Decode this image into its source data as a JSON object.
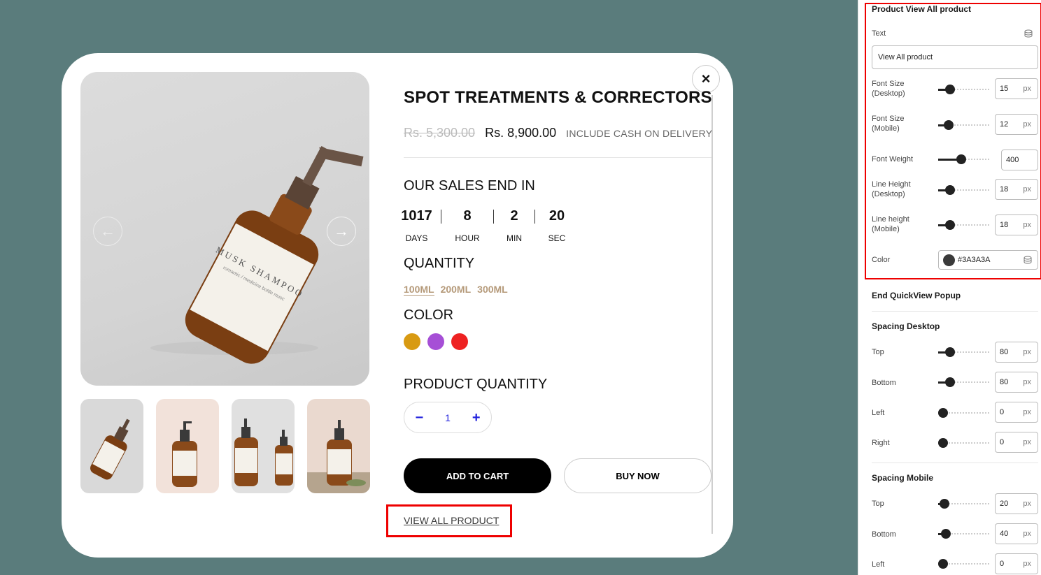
{
  "modal": {
    "title": "SPOT TREATMENTS & CORRECTORS",
    "price_old": "Rs. 5,300.00",
    "price_new": "Rs. 8,900.00",
    "price_note": "INCLUDE CASH ON DELIVERY",
    "sales_heading": "OUR SALES END IN",
    "timer": [
      {
        "value": "1017",
        "label": "DAYS"
      },
      {
        "value": "8",
        "label": "HOUR"
      },
      {
        "value": "2",
        "label": "MIN"
      },
      {
        "value": "20",
        "label": "SEC"
      }
    ],
    "quantity_heading": "QUANTITY",
    "sizes": [
      "100ML",
      "200ML",
      "300ML"
    ],
    "color_heading": "COLOR",
    "colors": [
      "#d89a12",
      "#a64fd6",
      "#ee2222"
    ],
    "product_quantity_heading": "PRODUCT QUANTITY",
    "stepper": {
      "minus": "−",
      "value": "1",
      "plus": "+"
    },
    "add_to_cart": "ADD TO CART",
    "buy_now": "BUY NOW",
    "view_all": "VIEW ALL PRODUCT",
    "close_icon": "×",
    "prev_icon": "←",
    "next_icon": "→",
    "bottle_label": "MUSK SHAMPOO",
    "bottle_sublabel": "romantic / medicine bottle musc"
  },
  "panel": {
    "section_title": "Product View All product",
    "text_label": "Text",
    "text_value": "View All product",
    "font_size_desktop_label": "Font Size\n(Desktop)",
    "font_size_desktop": "15",
    "font_size_mobile_label": "Font Size\n(Mobile)",
    "font_size_mobile": "12",
    "font_weight_label": "Font Weight",
    "font_weight": "400",
    "line_height_desktop_label": "Line Height\n(Desktop)",
    "line_height_desktop": "18",
    "line_height_mobile_label": "Line height\n(Mobile)",
    "line_height_mobile": "18",
    "color_label": "Color",
    "color_value": "#3A3A3A",
    "end_title": "End QuickView Popup",
    "spacing_desktop_title": "Spacing Desktop",
    "sd_top_label": "Top",
    "sd_top": "80",
    "sd_bottom_label": "Bottom",
    "sd_bottom": "80",
    "sd_left_label": "Left",
    "sd_left": "0",
    "sd_right_label": "Right",
    "sd_right": "0",
    "spacing_mobile_title": "Spacing Mobile",
    "sm_top_label": "Top",
    "sm_top": "20",
    "sm_bottom_label": "Bottom",
    "sm_bottom": "40",
    "sm_left_label": "Left",
    "sm_left": "0",
    "unit": "px"
  }
}
